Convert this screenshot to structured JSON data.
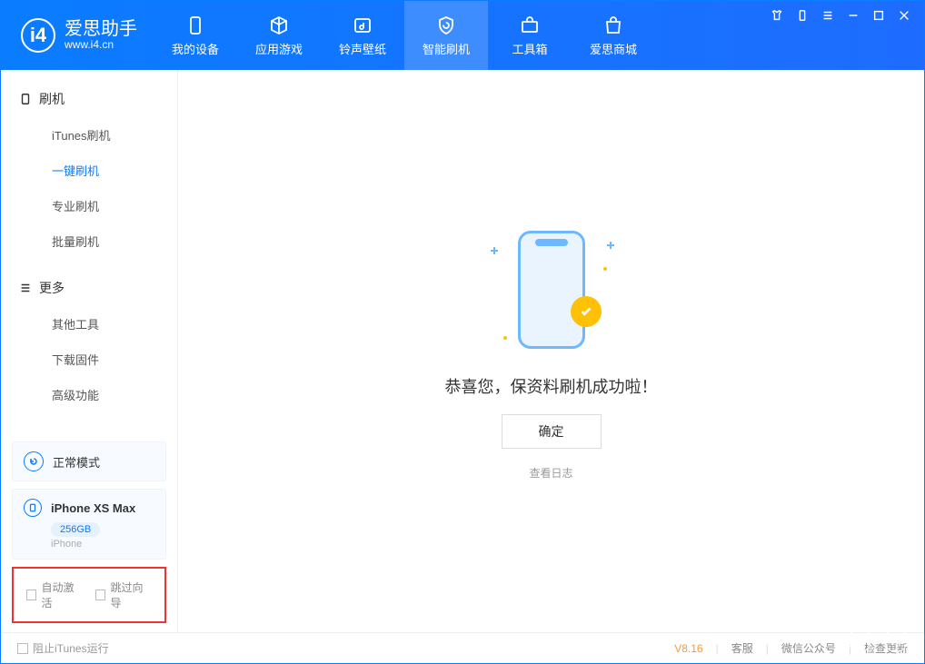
{
  "app": {
    "title": "爱思助手",
    "url": "www.i4.cn"
  },
  "tabs": {
    "device": "我的设备",
    "apps": "应用游戏",
    "ringtone": "铃声壁纸",
    "flash": "智能刷机",
    "toolbox": "工具箱",
    "store": "爱思商城"
  },
  "sidebar": {
    "section_flash": "刷机",
    "items_flash": {
      "itunes": "iTunes刷机",
      "onekey": "一键刷机",
      "pro": "专业刷机",
      "batch": "批量刷机"
    },
    "section_more": "更多",
    "items_more": {
      "other": "其他工具",
      "firmware": "下载固件",
      "advanced": "高级功能"
    },
    "mode_card": "正常模式",
    "device": {
      "name": "iPhone XS Max",
      "storage": "256GB",
      "type": "iPhone"
    },
    "opt_auto_activate": "自动激活",
    "opt_skip_guide": "跳过向导"
  },
  "main": {
    "success_msg": "恭喜您，保资料刷机成功啦！",
    "ok_btn": "确定",
    "log_link": "查看日志"
  },
  "footer": {
    "block_itunes": "阻止iTunes运行",
    "version": "V8.16",
    "support": "客服",
    "wechat": "微信公众号",
    "update": "检查更新"
  }
}
